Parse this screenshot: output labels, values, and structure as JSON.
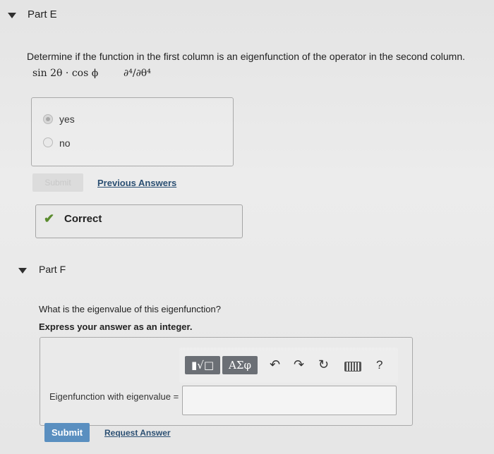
{
  "partE": {
    "title": "Part E",
    "question": "Determine if the function in the first column is an eigenfunction of the operator in the second column.",
    "function": "sin 2θ · cos ϕ",
    "operator": "∂⁴/∂θ⁴",
    "options": [
      "yes",
      "no"
    ],
    "selected": "yes",
    "submit_label": "Submit",
    "previous_answers_label": "Previous Answers",
    "feedback": "Correct"
  },
  "partF": {
    "title": "Part F",
    "question": "What is the eigenvalue of this eigenfunction?",
    "instruction": "Express your answer as an integer.",
    "toolbar": {
      "template_glyphs": "▮√□",
      "greek_glyphs": "ΑΣφ",
      "help": "?"
    },
    "answer_label": "Eigenfunction with eigenvalue =",
    "answer_value": "",
    "submit_label": "Submit",
    "request_answer_label": "Request Answer"
  },
  "colors": {
    "accent": "#5a8fc0",
    "link": "#2b4f72",
    "correct": "#5a8b2e",
    "toolbar": "#6b6f75"
  }
}
